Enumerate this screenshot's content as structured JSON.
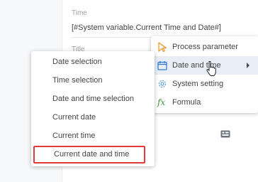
{
  "form": {
    "time_label": "Time",
    "time_value": "[#System variable.Current Time and Date#]",
    "title_label": "Title"
  },
  "main_menu": {
    "items": [
      {
        "label": "Process parameter",
        "icon": "process-parameter-icon"
      },
      {
        "label": "Date and time",
        "icon": "calendar-icon",
        "active": true
      },
      {
        "label": "System setting",
        "icon": "gear-icon"
      },
      {
        "label": "Formula",
        "icon": "fx-icon"
      }
    ]
  },
  "submenu": {
    "items": [
      {
        "label": "Date selection"
      },
      {
        "label": "Time selection"
      },
      {
        "label": "Date and time selection"
      },
      {
        "label": "Current date"
      },
      {
        "label": "Current time"
      },
      {
        "label": "Current date and time",
        "highlighted": true
      }
    ]
  },
  "colors": {
    "highlight_border": "#e23b3b",
    "active_item_bg": "#e9eef6",
    "process_icon": "#f0a23a",
    "calendar_icon": "#2f7bd3",
    "gear_icon": "#6aa7d8",
    "formula_icon": "#3a9a3a"
  }
}
